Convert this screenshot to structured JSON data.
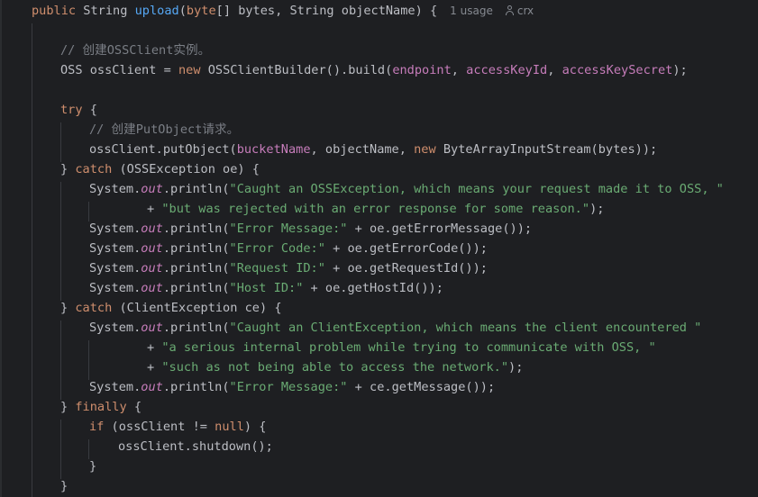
{
  "editor": {
    "header": {
      "kw_public": "public",
      "type_string": "String",
      "method_name": "upload",
      "open_paren": "(",
      "kw_byte": "byte",
      "params_rest": "[] bytes, String objectName) {",
      "usage_hint": "1 usage",
      "author_hint": "crx"
    },
    "lines": {
      "l2_comment": "// 创建OSSClient实例。",
      "l3_a": "OSS ossClient = ",
      "l3_new": "new",
      "l3_b": " OSSClientBuilder().build(",
      "l3_endpoint": "endpoint",
      "l3_c": ", ",
      "l3_keyid": "accessKeyId",
      "l3_d": ", ",
      "l3_secret": "accessKeySecret",
      "l3_e": ");",
      "l5_try": "try",
      "l5_rest": " {",
      "l6_comment": "// 创建PutObject请求。",
      "l7_a": "ossClient.putObject(",
      "l7_bucket": "bucketName",
      "l7_b": ", objectName, ",
      "l7_new": "new",
      "l7_c": " ByteArrayInputStream(bytes));",
      "l8_a": "} ",
      "l8_catch": "catch",
      "l8_b": " (OSSException oe) {",
      "l9_a": "System.",
      "l9_out": "out",
      "l9_b": ".println(",
      "l9_str": "\"Caught an OSSException, which means your request made it to OSS, \"",
      "l10_a": "+ ",
      "l10_str": "\"but was rejected with an error response for some reason.\"",
      "l10_b": ");",
      "l11_a": "System.",
      "l11_out": "out",
      "l11_b": ".println(",
      "l11_str": "\"Error Message:\"",
      "l11_c": " + oe.getErrorMessage());",
      "l12_a": "System.",
      "l12_out": "out",
      "l12_b": ".println(",
      "l12_str": "\"Error Code:\"",
      "l12_c": " + oe.getErrorCode());",
      "l13_a": "System.",
      "l13_out": "out",
      "l13_b": ".println(",
      "l13_str": "\"Request ID:\"",
      "l13_c": " + oe.getRequestId());",
      "l14_a": "System.",
      "l14_out": "out",
      "l14_b": ".println(",
      "l14_str": "\"Host ID:\"",
      "l14_c": " + oe.getHostId());",
      "l15_a": "} ",
      "l15_catch": "catch",
      "l15_b": " (ClientException ce) {",
      "l16_a": "System.",
      "l16_out": "out",
      "l16_b": ".println(",
      "l16_str": "\"Caught an ClientException, which means the client encountered \"",
      "l17_a": "+ ",
      "l17_str": "\"a serious internal problem while trying to communicate with OSS, \"",
      "l18_a": "+ ",
      "l18_str": "\"such as not being able to access the network.\"",
      "l18_b": ");",
      "l19_a": "System.",
      "l19_out": "out",
      "l19_b": ".println(",
      "l19_str": "\"Error Message:\"",
      "l19_c": " + ce.getMessage());",
      "l20_a": "} ",
      "l20_finally": "finally",
      "l20_b": " {",
      "l21_if": "if",
      "l21_a": " (ossClient != ",
      "l21_null": "null",
      "l21_b": ") {",
      "l22_a": "ossClient.shutdown();",
      "l23_a": "}",
      "l24_a": "}"
    },
    "colors": {
      "background": "#1e1f22",
      "keyword": "#cf8e6d",
      "method_declaration": "#56a8f5",
      "string": "#6aab73",
      "field": "#c77dbb",
      "comment": "#7a7e85",
      "default_text": "#bcbec4"
    }
  }
}
